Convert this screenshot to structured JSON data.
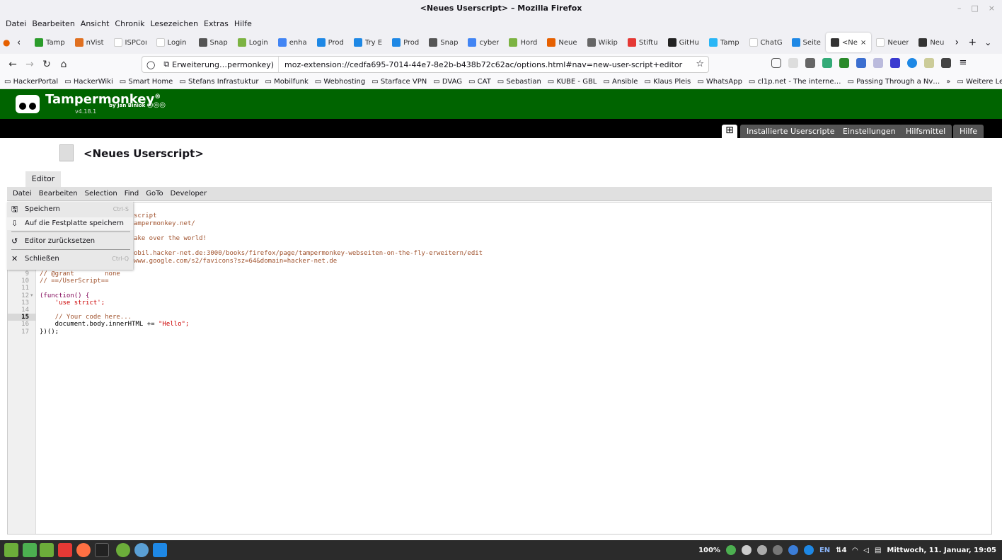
{
  "window": {
    "title": "<Neues Userscript> – Mozilla Firefox",
    "controls": [
      "–",
      "□",
      "×"
    ]
  },
  "menubar": [
    "Datei",
    "Bearbeiten",
    "Ansicht",
    "Chronik",
    "Lesezeichen",
    "Extras",
    "Hilfe"
  ],
  "tabs": [
    {
      "title": "Tamp",
      "color": "#2b9c2b"
    },
    {
      "title": "nVist",
      "color": "#e07020"
    },
    {
      "title": "ISPConfi",
      "color": "#ffffff"
    },
    {
      "title": "Login - C",
      "color": "#ffffff"
    },
    {
      "title": "Snap",
      "color": "#555555"
    },
    {
      "title": "Login",
      "color": "#7cb342"
    },
    {
      "title": "enha",
      "color": "#4285f4"
    },
    {
      "title": "Prod",
      "color": "#1e88e5"
    },
    {
      "title": "Try E",
      "color": "#1e88e5"
    },
    {
      "title": "Prod",
      "color": "#1e88e5"
    },
    {
      "title": "Snap",
      "color": "#555555"
    },
    {
      "title": "cyber",
      "color": "#4285f4"
    },
    {
      "title": "Hord",
      "color": "#7cb342"
    },
    {
      "title": "Neue",
      "color": "#e66000"
    },
    {
      "title": "Wikip",
      "color": "#666666"
    },
    {
      "title": "Stiftu",
      "color": "#e53935"
    },
    {
      "title": "GitHu",
      "color": "#222222"
    },
    {
      "title": "Tamp",
      "color": "#29b6f6"
    },
    {
      "title": "ChatGPT",
      "color": "#ffffff"
    },
    {
      "title": "Seite",
      "color": "#1e88e5"
    },
    {
      "title": "<Ne",
      "color": "#333333",
      "active": true
    },
    {
      "title": "Neuer Ta",
      "color": "#ffffff"
    },
    {
      "title": "Neu",
      "color": "#333333"
    }
  ],
  "tab_controls": {
    "more": "›",
    "new": "+",
    "list": "⌄"
  },
  "nav": {
    "identity": "Erweiterung…permonkey)",
    "url": "moz-extension://cedfa695-7014-44e7-8e2b-b438b72c62ac/options.html#nav=new-user-script+editor"
  },
  "bookmarks": [
    "HackerPortal",
    "HackerWiki",
    "Smart Home",
    "Stefans Infrastuktur",
    "Mobilfunk",
    "Webhosting",
    "Starface VPN",
    "DVAG",
    "CAT",
    "Sebastian",
    "KUBE - GBL",
    "Ansible",
    "Klaus Pleis",
    "WhatsApp",
    "cl1p.net - The interne…",
    "Passing Through a Nv…",
    "»",
    "Weitere Lesezeichen"
  ],
  "tm": {
    "title": "Tampermonkey",
    "reg": "®",
    "by": "by Jan Biniok",
    "version": "v4.18.1",
    "nav_tabs": [
      "Installierte Userscripte",
      "Einstellungen",
      "Hilfsmittel",
      "Hilfe"
    ],
    "plus": "⊞"
  },
  "script": {
    "title": "<Neues Userscript>",
    "editor_tab": "Editor"
  },
  "editor_menu": [
    "Datei",
    "Bearbeiten",
    "Selection",
    "Find",
    "GoTo",
    "Developer"
  ],
  "file_menu": [
    {
      "label": "Speichern",
      "shortcut": "Ctrl-S",
      "icon": "🖫"
    },
    {
      "label": "Auf die Festplatte speichern",
      "shortcut": "",
      "icon": "⇩"
    },
    {
      "label": "Editor zurücksetzen",
      "shortcut": "",
      "icon": "↺"
    },
    {
      "label": "Schließen",
      "shortcut": "Ctrl-Q",
      "icon": "✕"
    }
  ],
  "code_partial": [
    "script",
    "ampermonkey.net/",
    "ake over the world!",
    "obil.hacker-net.de:3000/books/firefox/page/tampermonkey-webseiten-on-the-fly-erweitern/edit",
    "www.google.com/s2/favicons?sz=64&domain=hacker-net.de"
  ],
  "line_numbers": [
    "9",
    "10",
    "11",
    "12",
    "13",
    "14",
    "15",
    "16",
    "17"
  ],
  "code_lines": [
    {
      "type": "cmt",
      "text": "// @grant        none"
    },
    {
      "type": "cmt",
      "text": "// ==/UserScript=="
    },
    {
      "type": "plain",
      "text": ""
    },
    {
      "type": "kw",
      "text": "(function() {"
    },
    {
      "type": "str",
      "text": "    'use strict';"
    },
    {
      "type": "plain",
      "text": ""
    },
    {
      "type": "cmt",
      "text": "    // Your code here..."
    },
    {
      "type": "mixed",
      "text": "    document.body.innerHTML += ",
      "str": "\"Hello\";"
    },
    {
      "type": "plain",
      "text": "})();"
    }
  ],
  "fold_marker": "▾",
  "tray": {
    "battery": "100%",
    "lang": "EN",
    "wifi": "4",
    "datetime": "Mittwoch, 11. Januar, 19:05"
  }
}
